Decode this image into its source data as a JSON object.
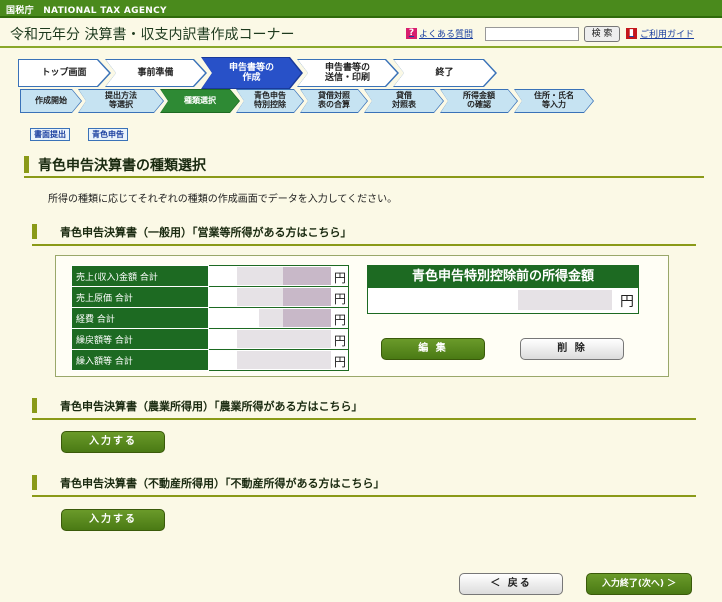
{
  "header": {
    "agency": "国税庁　NATIONAL TAX AGENCY",
    "title": "令和元年分 決算書・収支内訳書作成コーナー",
    "faq_label": "よくある質問",
    "search_placeholder": "",
    "search_button": "検 索",
    "guide_label": "ご利用ガイド"
  },
  "steps": [
    {
      "label": "トップ画面",
      "active": false
    },
    {
      "label": "事前準備",
      "active": false
    },
    {
      "label": "申告書等の\n作成",
      "active": true
    },
    {
      "label": "申告書等の\n送信・印刷",
      "active": false
    },
    {
      "label": "終了",
      "active": false
    }
  ],
  "substeps": [
    {
      "label": "作成開始",
      "active": false
    },
    {
      "label": "提出方法\n等選択",
      "active": false
    },
    {
      "label": "種類選択",
      "active": true
    },
    {
      "label": "青色申告\n特別控除",
      "active": false
    },
    {
      "label": "貸借対照\n表の合算",
      "active": false
    },
    {
      "label": "貸借\n対照表",
      "active": false
    },
    {
      "label": "所得金額\nの確認",
      "active": false
    },
    {
      "label": "住所・氏名\n等入力",
      "active": false
    }
  ],
  "tags": [
    "書面提出",
    "青色申告"
  ],
  "page": {
    "title": "青色申告決算書の種類選択",
    "description": "所得の種類に応じてそれぞれの種類の作成画面でデータを入力してください。"
  },
  "sections": {
    "general": {
      "heading": "青色申告決算書（一般用）「営業等所得がある方はこちら」",
      "rows": [
        {
          "label": "売上(収入)金額 合計",
          "unit": "円"
        },
        {
          "label": "売上原価 合計",
          "unit": "円"
        },
        {
          "label": "経費 合計",
          "unit": "円"
        },
        {
          "label": "繰戻額等 合計",
          "unit": "円"
        },
        {
          "label": "繰入額等 合計",
          "unit": "円"
        }
      ],
      "income_label": "青色申告特別控除前の所得金額",
      "income_unit": "円",
      "edit_button": "編 集",
      "delete_button": "削 除"
    },
    "agri": {
      "heading": "青色申告決算書（農業所得用）「農業所得がある方はこちら」",
      "input_button": "入力する"
    },
    "realestate": {
      "heading": "青色申告決算書（不動産所得用）「不動産所得がある方はこちら」",
      "input_button": "入力する"
    }
  },
  "footer": {
    "back_button": "＜ 戻る",
    "next_button": "入力終了(次へ) ＞"
  }
}
